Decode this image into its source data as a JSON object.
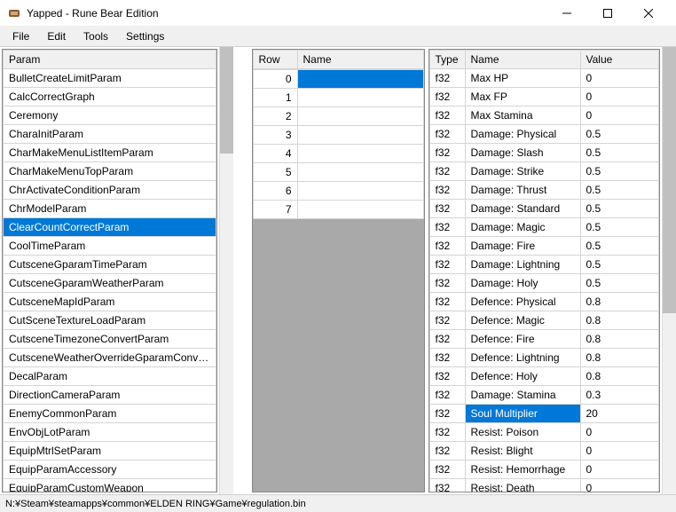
{
  "window": {
    "title": "Yapped - Rune Bear Edition"
  },
  "menu": {
    "file": "File",
    "edit": "Edit",
    "tools": "Tools",
    "settings": "Settings"
  },
  "params": {
    "header": "Param",
    "selectedIndex": 8,
    "items": [
      "BulletCreateLimitParam",
      "CalcCorrectGraph",
      "Ceremony",
      "CharaInitParam",
      "CharMakeMenuListItemParam",
      "CharMakeMenuTopParam",
      "ChrActivateConditionParam",
      "ChrModelParam",
      "ClearCountCorrectParam",
      "CoolTimeParam",
      "CutsceneGparamTimeParam",
      "CutsceneGparamWeatherParam",
      "CutsceneMapIdParam",
      "CutSceneTextureLoadParam",
      "CutsceneTimezoneConvertParam",
      "CutsceneWeatherOverrideGparamConvert...",
      "DecalParam",
      "DirectionCameraParam",
      "EnemyCommonParam",
      "EnvObjLotParam",
      "EquipMtrlSetParam",
      "EquipParamAccessory",
      "EquipParamCustomWeapon"
    ]
  },
  "rows": {
    "headers": {
      "row": "Row",
      "name": "Name"
    },
    "selectedIndex": 0,
    "items": [
      {
        "row": 0,
        "name": ""
      },
      {
        "row": 1,
        "name": ""
      },
      {
        "row": 2,
        "name": ""
      },
      {
        "row": 3,
        "name": ""
      },
      {
        "row": 4,
        "name": ""
      },
      {
        "row": 5,
        "name": ""
      },
      {
        "row": 6,
        "name": ""
      },
      {
        "row": 7,
        "name": ""
      }
    ]
  },
  "fields": {
    "headers": {
      "type": "Type",
      "name": "Name",
      "value": "Value"
    },
    "selectedNameIndex": 17,
    "items": [
      {
        "type": "f32",
        "name": "Max HP",
        "value": "0"
      },
      {
        "type": "f32",
        "name": "Max FP",
        "value": "0"
      },
      {
        "type": "f32",
        "name": "Max Stamina",
        "value": "0"
      },
      {
        "type": "f32",
        "name": "Damage: Physical",
        "value": "0.5"
      },
      {
        "type": "f32",
        "name": "Damage: Slash",
        "value": "0.5"
      },
      {
        "type": "f32",
        "name": "Damage: Strike",
        "value": "0.5"
      },
      {
        "type": "f32",
        "name": "Damage: Thrust",
        "value": "0.5"
      },
      {
        "type": "f32",
        "name": "Damage: Standard",
        "value": "0.5"
      },
      {
        "type": "f32",
        "name": "Damage: Magic",
        "value": "0.5"
      },
      {
        "type": "f32",
        "name": "Damage: Fire",
        "value": "0.5"
      },
      {
        "type": "f32",
        "name": "Damage: Lightning",
        "value": "0.5"
      },
      {
        "type": "f32",
        "name": "Damage: Holy",
        "value": "0.5"
      },
      {
        "type": "f32",
        "name": "Defence: Physical",
        "value": "0.8"
      },
      {
        "type": "f32",
        "name": "Defence: Magic",
        "value": "0.8"
      },
      {
        "type": "f32",
        "name": "Defence: Fire",
        "value": "0.8"
      },
      {
        "type": "f32",
        "name": "Defence: Lightning",
        "value": "0.8"
      },
      {
        "type": "f32",
        "name": "Defence: Holy",
        "value": "0.8"
      },
      {
        "type": "f32",
        "name": "Damage: Stamina",
        "value": "0.3"
      },
      {
        "type": "f32",
        "name": "Soul Multiplier",
        "value": "20"
      },
      {
        "type": "f32",
        "name": "Resist: Poison",
        "value": "0"
      },
      {
        "type": "f32",
        "name": "Resist: Blight",
        "value": "0"
      },
      {
        "type": "f32",
        "name": "Resist: Hemorrhage",
        "value": "0"
      },
      {
        "type": "f32",
        "name": "Resist: Death",
        "value": "0"
      }
    ]
  },
  "statusbar": {
    "path": "N:¥Steam¥steamapps¥common¥ELDEN RING¥Game¥regulation.bin"
  }
}
